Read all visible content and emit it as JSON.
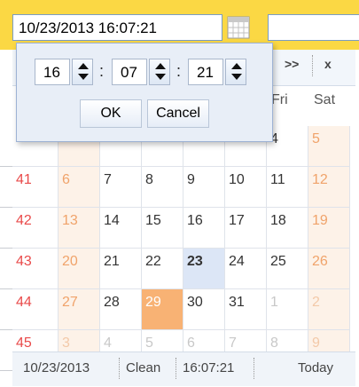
{
  "date_input": {
    "value": "10/23/2013 16:07:21"
  },
  "nav": {
    "next_year": ">>",
    "close": "x"
  },
  "weekday_headers": [
    "Fri",
    "Sat"
  ],
  "weeks": [
    {
      "week": "",
      "days": [
        "",
        "",
        "",
        "",
        "",
        "4",
        "5"
      ]
    },
    {
      "week": "41",
      "days": [
        "6",
        "7",
        "8",
        "9",
        "10",
        "11",
        "12"
      ]
    },
    {
      "week": "42",
      "days": [
        "13",
        "14",
        "15",
        "16",
        "17",
        "18",
        "19"
      ]
    },
    {
      "week": "43",
      "days": [
        "20",
        "21",
        "22",
        "23",
        "24",
        "25",
        "26"
      ]
    },
    {
      "week": "44",
      "days": [
        "27",
        "28",
        "29",
        "30",
        "31",
        "1",
        "2"
      ]
    },
    {
      "week": "45",
      "days": [
        "3",
        "4",
        "5",
        "6",
        "7",
        "8",
        "9"
      ]
    }
  ],
  "footer": {
    "date": "10/23/2013",
    "clean": "Clean",
    "time": "16:07:21",
    "today": "Today"
  },
  "time_popup": {
    "hour": "16",
    "minute": "07",
    "second": "21",
    "separator": ":",
    "ok": "OK",
    "cancel": "Cancel"
  },
  "colors": {
    "toolbar": "#fbd844",
    "weekend_bg": "#fdf2e8",
    "selected": "#f8b274",
    "today": "#dce6f6",
    "week_number": "#e94a4a"
  }
}
